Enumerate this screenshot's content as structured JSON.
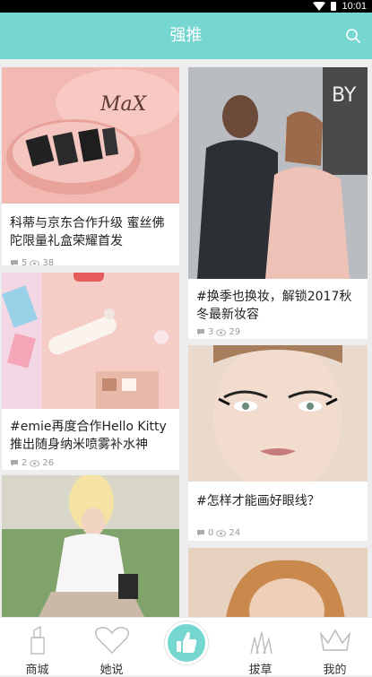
{
  "status_bar": {
    "time": "10:01"
  },
  "app_bar": {
    "title": "强推",
    "search_icon": "search-icon"
  },
  "cards": [
    {
      "title": "科蒂与京东合作升级 蜜丝佛陀限量礼盒荣耀首发",
      "comments": "5",
      "views": "38"
    },
    {
      "title": "#换季也换妆，解锁2017秋冬最新妆容",
      "comments": "3",
      "views": "29"
    },
    {
      "title": "#emie再度合作Hello Kitty 推出随身纳米喷雾补水神",
      "comments": "2",
      "views": "26"
    },
    {
      "title": "#怎样才能画好眼线？",
      "comments": "0",
      "views": "24"
    }
  ],
  "tab_bar": {
    "tabs": [
      {
        "label": "商城",
        "icon": "lipstick-icon"
      },
      {
        "label": "她说",
        "icon": "heart-icon"
      },
      {
        "label": "",
        "icon": "thumbs-up-icon"
      },
      {
        "label": "拔草",
        "icon": "grass-icon"
      },
      {
        "label": "我的",
        "icon": "crown-icon"
      }
    ]
  },
  "colors": {
    "accent": "#76d6d0",
    "background": "#ededed",
    "text": "#222222",
    "meta": "#999999"
  }
}
